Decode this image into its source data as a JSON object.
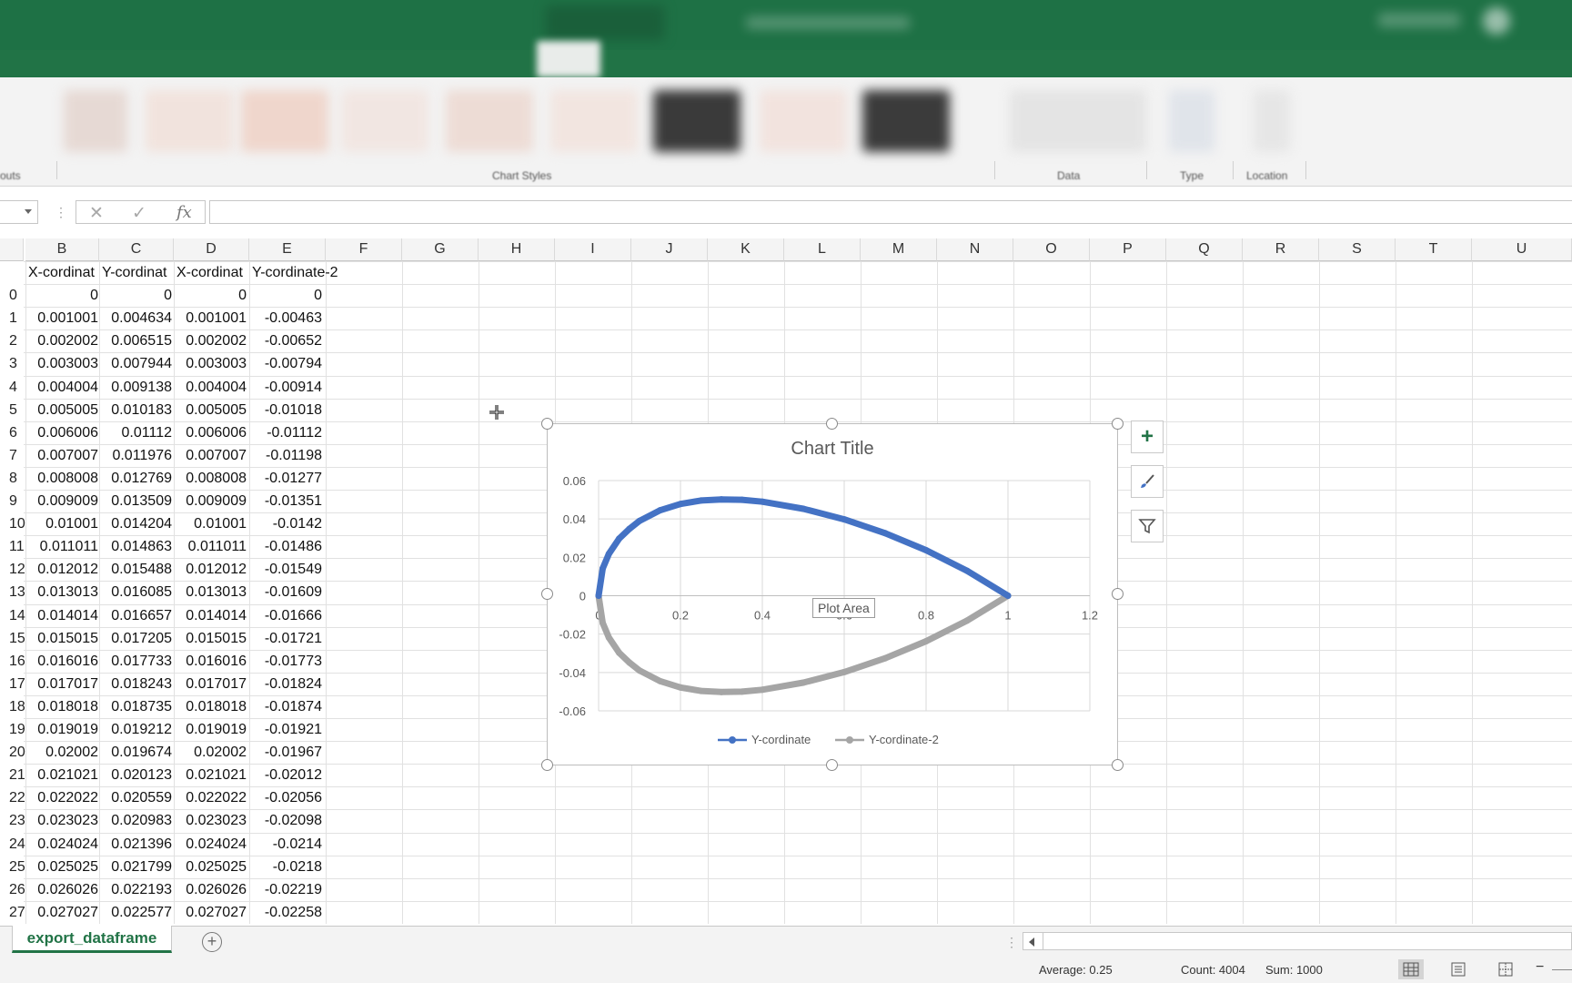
{
  "ribbon": {
    "group_labels": [
      "outs",
      "Chart Styles",
      "Data",
      "Type",
      "Location"
    ]
  },
  "formula_bar": {
    "fx_label": "fx",
    "cancel_symbol": "✕",
    "enter_symbol": "✓",
    "formula": ""
  },
  "sheet": {
    "columns": [
      "B",
      "C",
      "D",
      "E",
      "F",
      "G",
      "H",
      "I",
      "J",
      "K",
      "L",
      "M",
      "N",
      "O",
      "P",
      "Q",
      "R",
      "S",
      "T",
      "U"
    ],
    "headers": [
      "X-cordinat",
      "Y-cordinat",
      "X-cordinat",
      "Y-cordinate-2"
    ],
    "row_numbers": [
      "0",
      "1",
      "2",
      "3",
      "4",
      "5",
      "6",
      "7",
      "8",
      "9",
      "10",
      "11",
      "12",
      "13",
      "14",
      "15",
      "16",
      "17",
      "18",
      "19",
      "20",
      "21",
      "22",
      "23",
      "24",
      "25",
      "26",
      "27"
    ],
    "rows": [
      [
        "0",
        "0",
        "0",
        "0"
      ],
      [
        "0.001001",
        "0.004634",
        "0.001001",
        "-0.00463"
      ],
      [
        "0.002002",
        "0.006515",
        "0.002002",
        "-0.00652"
      ],
      [
        "0.003003",
        "0.007944",
        "0.003003",
        "-0.00794"
      ],
      [
        "0.004004",
        "0.009138",
        "0.004004",
        "-0.00914"
      ],
      [
        "0.005005",
        "0.010183",
        "0.005005",
        "-0.01018"
      ],
      [
        "0.006006",
        "0.01112",
        "0.006006",
        "-0.01112"
      ],
      [
        "0.007007",
        "0.011976",
        "0.007007",
        "-0.01198"
      ],
      [
        "0.008008",
        "0.012769",
        "0.008008",
        "-0.01277"
      ],
      [
        "0.009009",
        "0.013509",
        "0.009009",
        "-0.01351"
      ],
      [
        "0.01001",
        "0.014204",
        "0.01001",
        "-0.0142"
      ],
      [
        "0.011011",
        "0.014863",
        "0.011011",
        "-0.01486"
      ],
      [
        "0.012012",
        "0.015488",
        "0.012012",
        "-0.01549"
      ],
      [
        "0.013013",
        "0.016085",
        "0.013013",
        "-0.01609"
      ],
      [
        "0.014014",
        "0.016657",
        "0.014014",
        "-0.01666"
      ],
      [
        "0.015015",
        "0.017205",
        "0.015015",
        "-0.01721"
      ],
      [
        "0.016016",
        "0.017733",
        "0.016016",
        "-0.01773"
      ],
      [
        "0.017017",
        "0.018243",
        "0.017017",
        "-0.01824"
      ],
      [
        "0.018018",
        "0.018735",
        "0.018018",
        "-0.01874"
      ],
      [
        "0.019019",
        "0.019212",
        "0.019019",
        "-0.01921"
      ],
      [
        "0.02002",
        "0.019674",
        "0.02002",
        "-0.01967"
      ],
      [
        "0.021021",
        "0.020123",
        "0.021021",
        "-0.02012"
      ],
      [
        "0.022022",
        "0.020559",
        "0.022022",
        "-0.02056"
      ],
      [
        "0.023023",
        "0.020983",
        "0.023023",
        "-0.02098"
      ],
      [
        "0.024024",
        "0.021396",
        "0.024024",
        "-0.0214"
      ],
      [
        "0.025025",
        "0.021799",
        "0.025025",
        "-0.0218"
      ],
      [
        "0.026026",
        "0.022193",
        "0.026026",
        "-0.02219"
      ],
      [
        "0.027027",
        "0.022577",
        "0.027027",
        "-0.02258"
      ]
    ]
  },
  "chart_data": {
    "type": "scatter",
    "title": "Chart Title",
    "xlabel": "",
    "ylabel": "",
    "xlim": [
      0,
      1.2
    ],
    "ylim": [
      -0.06,
      0.06
    ],
    "x_ticks": [
      "0",
      "0.2",
      "0.4",
      "0.6",
      "0.8",
      "1",
      "1.2"
    ],
    "y_ticks": [
      "0.06",
      "0.04",
      "0.02",
      "0",
      "-0.02",
      "-0.04",
      "-0.06"
    ],
    "grid": true,
    "legend_position": "bottom",
    "series": [
      {
        "name": "Y-cordinate",
        "color": "#4472c4",
        "x": [
          0,
          0.01,
          0.025,
          0.05,
          0.075,
          0.1,
          0.15,
          0.2,
          0.25,
          0.3,
          0.35,
          0.4,
          0.5,
          0.6,
          0.7,
          0.8,
          0.9,
          1.0
        ],
        "y": [
          0,
          0.0142,
          0.0218,
          0.0297,
          0.0348,
          0.039,
          0.0445,
          0.0478,
          0.0496,
          0.0502,
          0.05,
          0.049,
          0.0453,
          0.0398,
          0.0326,
          0.0237,
          0.013,
          0
        ]
      },
      {
        "name": "Y-cordinate-2",
        "color": "#a5a5a5",
        "x": [
          0,
          0.01,
          0.025,
          0.05,
          0.075,
          0.1,
          0.15,
          0.2,
          0.25,
          0.3,
          0.35,
          0.4,
          0.5,
          0.6,
          0.7,
          0.8,
          0.9,
          1.0
        ],
        "y": [
          0,
          -0.0142,
          -0.0218,
          -0.0297,
          -0.0348,
          -0.039,
          -0.0445,
          -0.0478,
          -0.0496,
          -0.0502,
          -0.05,
          -0.049,
          -0.0453,
          -0.0398,
          -0.0326,
          -0.0237,
          -0.013,
          0
        ]
      }
    ]
  },
  "chart_ui": {
    "tooltip": "Plot Area",
    "add_element_symbol": "+",
    "styles_icon": "brush-icon",
    "filter_icon": "filter-icon"
  },
  "tabs": {
    "sheet_name": "export_dataframe",
    "add_symbol": "+"
  },
  "status": {
    "average": "Average: 0.25",
    "count": "Count: 4004",
    "sum": "Sum: 1000",
    "zoom_minus": "−"
  }
}
